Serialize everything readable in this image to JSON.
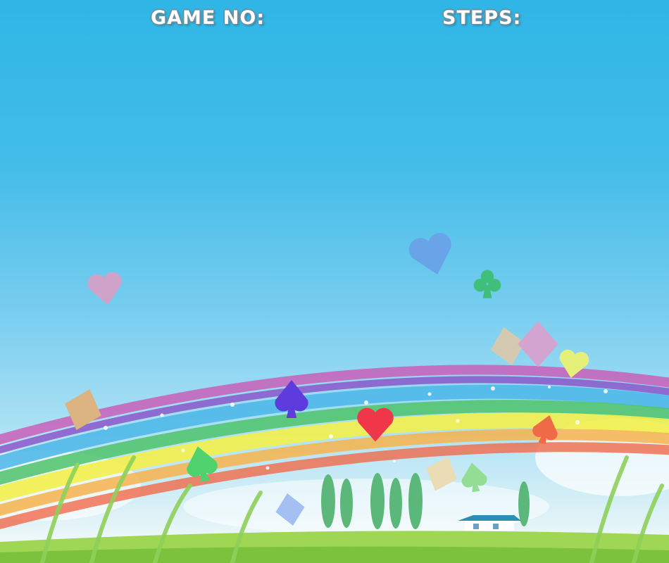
{
  "hud": {
    "game_no_label": "GAME NO:",
    "game_no_value": "",
    "steps_label": "STEPS:",
    "steps_value": ""
  },
  "colors": {
    "sky_top": "#2fb6e6",
    "sky_bottom": "#dff2f7",
    "grass": "#9fd653",
    "rainbow": [
      "#c95fb8",
      "#8a4fc7",
      "#4ab6e8",
      "#4fc36a",
      "#f4ef4c",
      "#f7b34c",
      "#f06a4a"
    ]
  },
  "floating_suits": [
    {
      "suit": "heart-icon",
      "color": "#cfa2c9"
    },
    {
      "suit": "heart-icon",
      "color": "#6aa4e8"
    },
    {
      "suit": "club-icon",
      "color": "#3fbf7a"
    },
    {
      "suit": "diamond-icon",
      "color": "#e2c8a6"
    },
    {
      "suit": "diamond-icon",
      "color": "#d8a1cf"
    },
    {
      "suit": "heart-icon",
      "color": "#e5f07a"
    },
    {
      "suit": "diamond-icon",
      "color": "#dcb482"
    },
    {
      "suit": "spade-icon",
      "color": "#5d3bdc"
    },
    {
      "suit": "heart-icon",
      "color": "#f0374a"
    },
    {
      "suit": "spade-icon",
      "color": "#ef6a47"
    },
    {
      "suit": "spade-icon",
      "color": "#4fd26e"
    },
    {
      "suit": "diamond-icon",
      "color": "#eadcb5"
    },
    {
      "suit": "spade-icon",
      "color": "#93dd95"
    },
    {
      "suit": "diamond-icon",
      "color": "#a4bff2"
    }
  ]
}
